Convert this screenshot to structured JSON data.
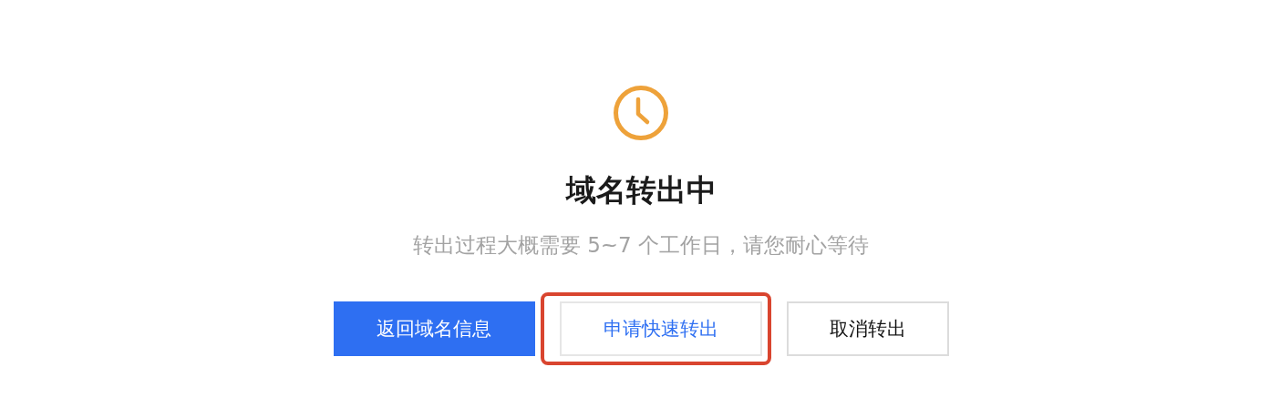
{
  "status": {
    "title": "域名转出中",
    "description": "转出过程大概需要 5~7 个工作日，请您耐心等待"
  },
  "buttons": [
    {
      "label": "返回域名信息",
      "kind": "primary",
      "highlighted": false
    },
    {
      "label": "申请快速转出",
      "kind": "link",
      "highlighted": true
    },
    {
      "label": "取消转出",
      "kind": "default",
      "highlighted": false
    }
  ]
}
